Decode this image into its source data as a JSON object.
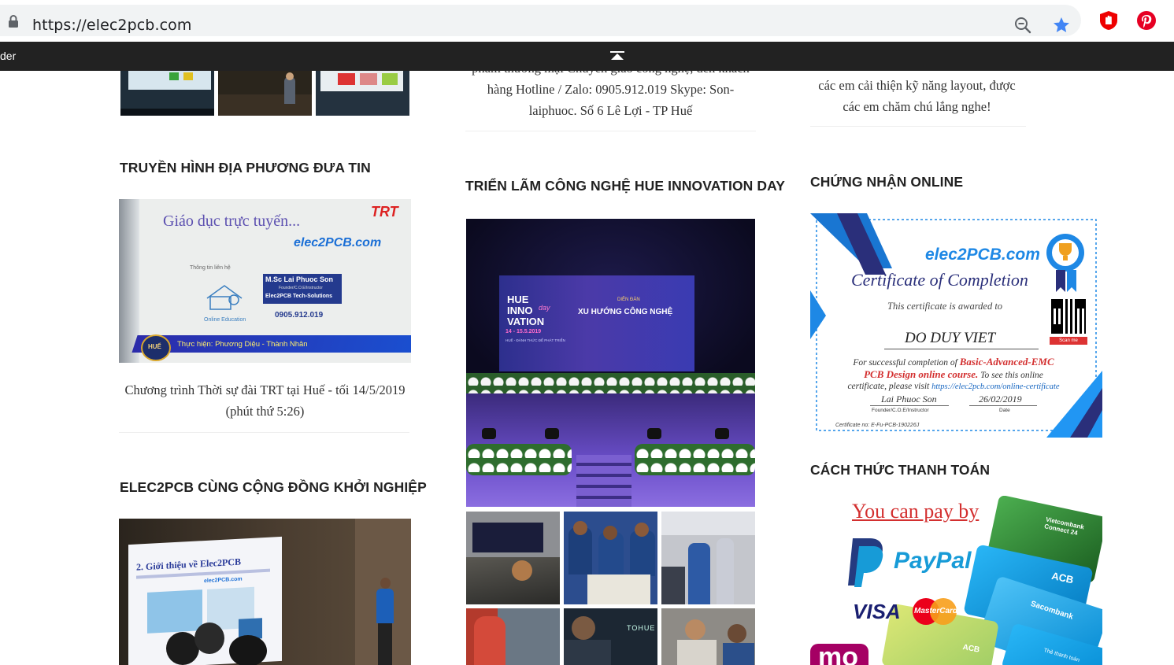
{
  "browser": {
    "url_host": "https://elec2pcb.com",
    "icons": [
      "lock-icon",
      "zoom-icon",
      "star-icon",
      "ublock-extension-icon",
      "pinterest-extension-icon"
    ]
  },
  "sticky_bar": {
    "left_text": "der",
    "scroll_top_icon": "chevron-up-icon"
  },
  "col1": {
    "truyen_hinh": {
      "title": "TRUYỀN HÌNH ĐỊA PHƯƠNG ĐƯA TIN",
      "caption_line1": "Chương trình Thời sự đài TRT tại Huế - tối 14/5/2019",
      "caption_line2": "(phút thứ 5:26)",
      "video": {
        "heading": "Giáo dục trực tuyến...",
        "logo": "elec2PCB.com",
        "channel": "TRT",
        "contact_label": "Thông tin liên hệ",
        "name": "M.Sc Lai Phuoc Son",
        "role": "Founder/C.O.E/Instructor",
        "company": "Elec2PCB Tech-Solutions",
        "phone": "0905.912.019",
        "online_label": "Online Education",
        "credit": "Thực hiện: Phương Diệu - Thành Nhân",
        "badge": "HUẾ"
      }
    },
    "khoi_nghiep": {
      "title": "ELEC2PCB CÙNG CỘNG ĐỒNG KHỞI NGHIỆP",
      "slide_title": "2. Giới thiệu về Elec2PCB",
      "slide_logo": "elec2PCB.com"
    }
  },
  "col2": {
    "top_caption_line0": "phẩm thương mại Chuyển giao công nghệ, đến khách",
    "top_caption_line1": "hàng Hotline / Zalo: 0905.912.019 Skype: Son-",
    "top_caption_line2": "laiphuoc. Số 6 Lê Lợi - TP Huế",
    "innovation": {
      "title": "TRIỂN LÃM CÔNG NGHỆ HUE INNOVATION DAY",
      "screen_left": "HUE INNO VATION",
      "screen_day": "day",
      "screen_date": "14 - 15.5.2019",
      "screen_sub": "HUẾ - ĐÁNH THỨC ĐỂ PHÁT TRIỂN",
      "screen_forum_label": "DIỄN ĐÀN",
      "screen_forum": "XU HƯỚNG CÔNG NGHỆ",
      "booth_sign": "TOHUE"
    }
  },
  "col3": {
    "top_caption_line1": "các em cải thiện kỹ năng layout, được",
    "top_caption_line2": "các em chăm chú lắng nghe!",
    "certificate": {
      "title": "CHỨNG NHẬN ONLINE",
      "logo": "elec2PCB.com",
      "heading": "Certificate of Completion",
      "awarded": "This certificate is awarded to",
      "name": "DO DUY VIET",
      "line1_a": "For successful completion of ",
      "line1_b": "Basic-Advanced-EMC",
      "line2_a": "PCB Design online course.",
      "line2_b": " To see this online",
      "line3_a": "certificate, please visit ",
      "line3_b": "https://elec2pcb.com/online-certificate",
      "signature": "Lai Phuoc Son",
      "sig_role": "Founder/C.O.E/Instructor",
      "date": "26/02/2019",
      "date_label": "Date",
      "cert_no": "Certificate no: E-Fu-PCB-190226J",
      "qr_caption": "Scan me"
    },
    "payment": {
      "title": "CÁCH THỨC THANH TOÁN",
      "headline": "You can pay by",
      "paypal": "PayPal",
      "visa": "VISA",
      "mastercard": "MasterCard",
      "cards": [
        "Vietcombank Connect 24",
        "ACB",
        "Sacombank",
        "ACB",
        "Thẻ thanh toán"
      ],
      "momo": "mo"
    }
  }
}
